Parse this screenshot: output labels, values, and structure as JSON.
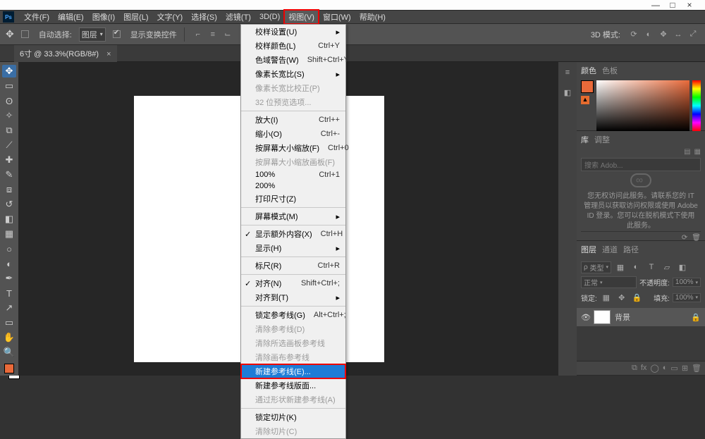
{
  "window": {
    "min": "—",
    "max": "□",
    "close": "×"
  },
  "menubar": {
    "file": "文件(F)",
    "edit": "编辑(E)",
    "image": "图像(I)",
    "layer": "图层(L)",
    "type": "文字(Y)",
    "select": "选择(S)",
    "filter": "滤镜(T)",
    "threeD": "3D(D)",
    "view": "视图(V)",
    "window": "窗口(W)",
    "help": "帮助(H)"
  },
  "options": {
    "autoSelectLabel": "自动选择:",
    "autoSelectValue": "图层",
    "showTransform": "显示变换控件",
    "threeDMode": "3D 模式:"
  },
  "docTab": {
    "title": "6寸 @ 33.3%(RGB/8#)",
    "close": "×"
  },
  "viewMenu": {
    "proofSetup": {
      "label": "校样设置(U)"
    },
    "proofColors": {
      "label": "校样颜色(L)",
      "sc": "Ctrl+Y"
    },
    "gamutWarning": {
      "label": "色域警告(W)",
      "sc": "Shift+Ctrl+Y"
    },
    "pixelAspect": {
      "label": "像素长宽比(S)"
    },
    "pixelAspectCorr": {
      "label": "像素长宽比校正(P)"
    },
    "preview32": {
      "label": "32 位预览选项..."
    },
    "zoomIn": {
      "label": "放大(I)",
      "sc": "Ctrl++"
    },
    "zoomOut": {
      "label": "缩小(O)",
      "sc": "Ctrl+-"
    },
    "fitScreen": {
      "label": "按屏幕大小缩放(F)",
      "sc": "Ctrl+0"
    },
    "fitArtboard": {
      "label": "按屏幕大小缩放画板(F)"
    },
    "hundred": {
      "label": "100%",
      "sc": "Ctrl+1"
    },
    "twoHundred": {
      "label": "200%"
    },
    "printSize": {
      "label": "打印尺寸(Z)"
    },
    "screenMode": {
      "label": "屏幕模式(M)"
    },
    "extras": {
      "label": "显示额外内容(X)",
      "sc": "Ctrl+H"
    },
    "show": {
      "label": "显示(H)"
    },
    "rulers": {
      "label": "标尺(R)",
      "sc": "Ctrl+R"
    },
    "snap": {
      "label": "对齐(N)",
      "sc": "Shift+Ctrl+;"
    },
    "snapTo": {
      "label": "对齐到(T)"
    },
    "lockGuides": {
      "label": "锁定参考线(G)",
      "sc": "Alt+Ctrl+;"
    },
    "clearGuides": {
      "label": "清除参考线(D)"
    },
    "clearArtboardGuides": {
      "label": "清除所选画板参考线"
    },
    "clearCanvasGuides": {
      "label": "清除画布参考线"
    },
    "newGuide": {
      "label": "新建参考线(E)..."
    },
    "newGuideLayout": {
      "label": "新建参考线版面..."
    },
    "guidesFromShape": {
      "label": "通过形状新建参考线(A)"
    },
    "lockSlices": {
      "label": "锁定切片(K)"
    },
    "clearSlices": {
      "label": "清除切片(C)"
    }
  },
  "panels": {
    "color": {
      "tab1": "颜色",
      "tab2": "色板"
    },
    "library": {
      "tab1": "库",
      "tab2": "调整",
      "search": "搜索 Adob...",
      "message": "您无权访问此服务。请联系您的 IT 管理员以获取访问权限或使用 Adobe ID 登录。您可以在脱机模式下使用此服务。"
    },
    "layers": {
      "tab1": "图层",
      "tab2": "通道",
      "tab3": "路径",
      "kind": "类型",
      "blend": "正常",
      "opacityLabel": "不透明度:",
      "opacity": "100%",
      "lockLabel": "锁定:",
      "fillLabel": "填充:",
      "fill": "100%",
      "bgLayer": "背景"
    }
  }
}
